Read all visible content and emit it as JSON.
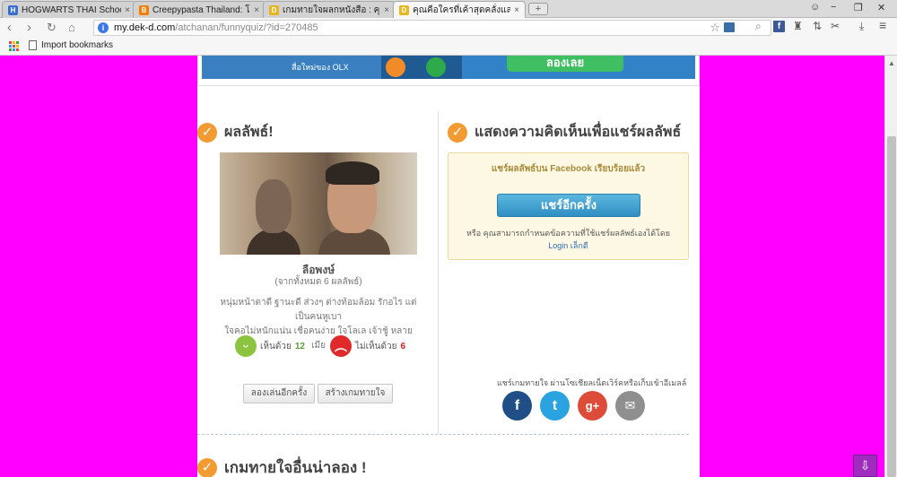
{
  "browser": {
    "tabs": [
      {
        "title": "HOGWARTS THAI School |",
        "fav_color": "#3a6fd1",
        "fav_glyph": "H"
      },
      {
        "title": "Creepypasta Thailand: โปรด",
        "fav_color": "#f57d00",
        "fav_glyph": "B"
      },
      {
        "title": "เกมทายใจผลกหนังสือ : คุณเป็นได้",
        "fav_color": "#e7b51f",
        "fav_glyph": "D"
      },
      {
        "title": "คุณคือใครที่เค้าสุดคลั่งแสนรัก จากน",
        "fav_color": "#e7b51f",
        "fav_glyph": "D"
      }
    ],
    "url_host": "my.dek-d.com",
    "url_path": "/atchanan/funnyquiz/?id=270485",
    "bookmark_label": "Import bookmarks",
    "icons": [
      "back-icon",
      "forward-icon",
      "reload-icon",
      "home-icon",
      "star-icon",
      "search-icon",
      "facebook-icon",
      "menu-icon"
    ]
  },
  "page": {
    "banner": {
      "logo_text": "สื่อใหม่ของ OLX",
      "button_text": "ลองเลย"
    },
    "result": {
      "title": "ผลลัพธ์!",
      "name": "ลือพงษ์",
      "count": "(จากทั้งหมด 6 ผลลัพธ์)",
      "desc_line1": "หนุ่มหน้าตาดี ฐานะดี ส่วงๆ ต่างท้อมล้อม รักอไร แต่เป็นคนหูเบา",
      "desc_line2": "ใจคอไม่หนักแน่น เชื่อคนง่าย ใจโลเล เจ้าชู้ หลายเมีย",
      "agree_label": "เห็นด้วย",
      "agree_count": "12",
      "disagree_label": "ไม่เห็นด้วย",
      "disagree_count": "6",
      "replay_button": "ลองเล่นอีกครั้ง",
      "create_button": "สร้างเกมทายใจ"
    },
    "comment": {
      "title": "แสดงความคิดเห็นเพื่อแชร์ผลลัพธ์",
      "shared_msg": "แชร์ผลลัพธ์บน Facebook เรียบร้อยแล้ว",
      "share_again_button": "แชร์อีกครั้ง",
      "note": "หรือ คุณสามารถกำหนดข้อความที่ใช้แชร์ผลลัพธ์เองได้โดย",
      "login_link": "Login เล็กดี",
      "social_label": "แชร์เกมทายใจ ผ่านโซเชียลเน็ตเวิร์คหรือเก็บเข้าอีเมลล์"
    },
    "more_title": "เกมทายใจอื่นน่าลอง !"
  },
  "colors": {
    "background": "#ff00ff",
    "accent": "#f29b30",
    "facebook": "#3b5998",
    "twitter": "#1da1f2",
    "googleplus": "#dd4b39",
    "email": "#8f8f8f"
  }
}
